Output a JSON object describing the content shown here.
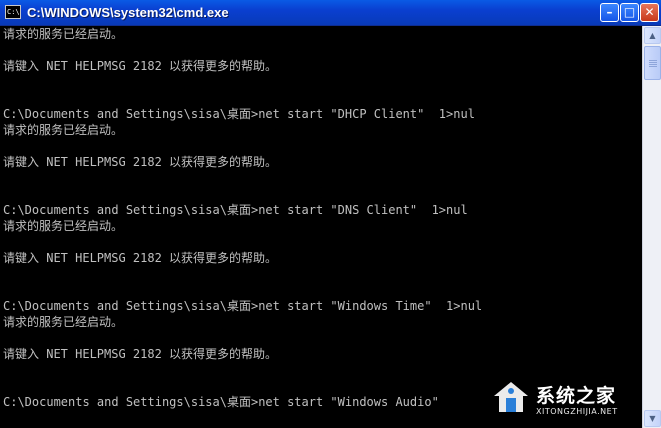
{
  "window": {
    "title": "C:\\WINDOWS\\system32\\cmd.exe",
    "icon_text": "C:\\",
    "minimize_glyph": "–",
    "maximize_glyph": "□",
    "close_glyph": "✕"
  },
  "console": {
    "lines": [
      "请求的服务已经启动。",
      "",
      "请键入 NET HELPMSG 2182 以获得更多的帮助。",
      "",
      "",
      "C:\\Documents and Settings\\sisa\\桌面>net start \"DHCP Client\"  1>nul",
      "请求的服务已经启动。",
      "",
      "请键入 NET HELPMSG 2182 以获得更多的帮助。",
      "",
      "",
      "C:\\Documents and Settings\\sisa\\桌面>net start \"DNS Client\"  1>nul",
      "请求的服务已经启动。",
      "",
      "请键入 NET HELPMSG 2182 以获得更多的帮助。",
      "",
      "",
      "C:\\Documents and Settings\\sisa\\桌面>net start \"Windows Time\"  1>nul",
      "请求的服务已经启动。",
      "",
      "请键入 NET HELPMSG 2182 以获得更多的帮助。",
      "",
      "",
      "C:\\Documents and Settings\\sisa\\桌面>net start \"Windows Audio\""
    ]
  },
  "scrollbar": {
    "up_glyph": "▲",
    "down_glyph": "▼"
  },
  "watermark": {
    "name": "系统之家",
    "url": "XITONGZHIJIA.NET"
  },
  "colors": {
    "titlebar": "#0a4fd9",
    "console_bg": "#000000",
    "console_text": "#c0c0c0",
    "close_button": "#d3461f"
  }
}
